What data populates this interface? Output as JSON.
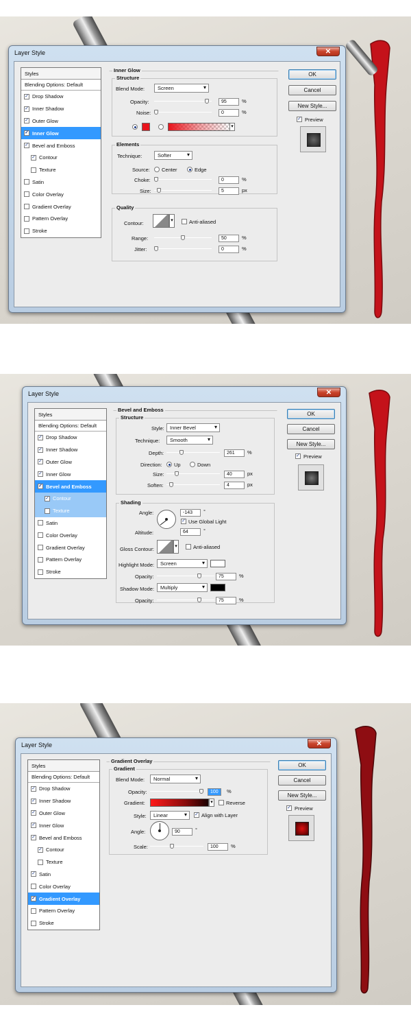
{
  "dialog_title": "Layer Style",
  "close_symbol": "✕",
  "styles_header": "Styles",
  "blending_options": "Blending Options: Default",
  "buttons": {
    "ok": "OK",
    "cancel": "Cancel",
    "new_style": "New Style...",
    "preview": "Preview"
  },
  "style_items": [
    "Drop Shadow",
    "Inner Shadow",
    "Outer Glow",
    "Inner Glow",
    "Bevel and Emboss",
    "Contour",
    "Texture",
    "Satin",
    "Color Overlay",
    "Gradient Overlay",
    "Pattern Overlay",
    "Stroke"
  ],
  "panel1": {
    "checked": [
      true,
      true,
      true,
      true,
      true,
      true,
      false,
      false,
      false,
      false,
      false,
      false
    ],
    "selected_index": 3,
    "section": "Inner Glow",
    "structure": "Structure",
    "blend_mode_label": "Blend Mode:",
    "blend_mode": "Screen",
    "opacity_label": "Opacity:",
    "opacity": "95",
    "opacity_level": 0.95,
    "noise_label": "Noise:",
    "noise": "0",
    "noise_level": 0,
    "percent": "%",
    "glow_color": "#e8141c",
    "elements": "Elements",
    "technique_label": "Technique:",
    "technique": "Softer",
    "source_label": "Source:",
    "source_center": "Center",
    "source_edge": "Edge",
    "choke_label": "Choke:",
    "choke": "0",
    "choke_level": 0,
    "size_label": "Size:",
    "size": "5",
    "size_level": 0.05,
    "px": "px",
    "quality": "Quality",
    "contour_label": "Contour:",
    "anti_aliased": "Anti-aliased",
    "range_label": "Range:",
    "range": "50",
    "range_level": 0.5,
    "jitter_label": "Jitter:",
    "jitter": "0",
    "jitter_level": 0
  },
  "panel2": {
    "checked": [
      true,
      true,
      true,
      true,
      true,
      true,
      false,
      false,
      false,
      false,
      false,
      false
    ],
    "selected_index": 4,
    "section": "Bevel and Emboss",
    "structure": "Structure",
    "style_label": "Style:",
    "style": "Inner Bevel",
    "technique_label": "Technique:",
    "technique": "Smooth",
    "depth_label": "Depth:",
    "depth": "261",
    "depth_level": 0.26,
    "direction_label": "Direction:",
    "dir_up": "Up",
    "dir_down": "Down",
    "size_label": "Size:",
    "size": "40",
    "size_level": 0.16,
    "soften_label": "Soften:",
    "soften": "4",
    "soften_level": 0.05,
    "px": "px",
    "percent": "%",
    "degree": "°",
    "shading": "Shading",
    "angle_label": "Angle:",
    "angle": "-143",
    "angle_deg": -143,
    "use_global_light": "Use Global Light",
    "altitude_label": "Altitude:",
    "altitude": "64",
    "gloss_contour_label": "Gloss Contour:",
    "anti_aliased": "Anti-aliased",
    "highlight_mode_label": "Highlight Mode:",
    "highlight_mode": "Screen",
    "highlight_color": "#ffffff",
    "hl_opacity_label": "Opacity:",
    "hl_opacity": "75",
    "hl_opacity_level": 0.75,
    "shadow_mode_label": "Shadow Mode:",
    "shadow_mode": "Multiply",
    "shadow_color": "#000000",
    "sh_opacity_label": "Opacity:",
    "sh_opacity": "75",
    "sh_opacity_level": 0.75
  },
  "panel3": {
    "checked": [
      true,
      true,
      true,
      true,
      true,
      true,
      false,
      true,
      false,
      true,
      false,
      false
    ],
    "selected_index": 9,
    "section": "Gradient Overlay",
    "gradient_group": "Gradient",
    "blend_mode_label": "Blend Mode:",
    "blend_mode": "Normal",
    "opacity_label": "Opacity:",
    "opacity": "100",
    "opacity_level": 1.0,
    "gradient_label": "Gradient:",
    "reverse": "Reverse",
    "style_label": "Style:",
    "style": "Linear",
    "align_with_layer": "Align with Layer",
    "angle_label": "Angle:",
    "angle": "90",
    "angle_deg": 90,
    "degree": "°",
    "scale_label": "Scale:",
    "scale": "100",
    "scale_level": 0.4,
    "percent": "%"
  }
}
